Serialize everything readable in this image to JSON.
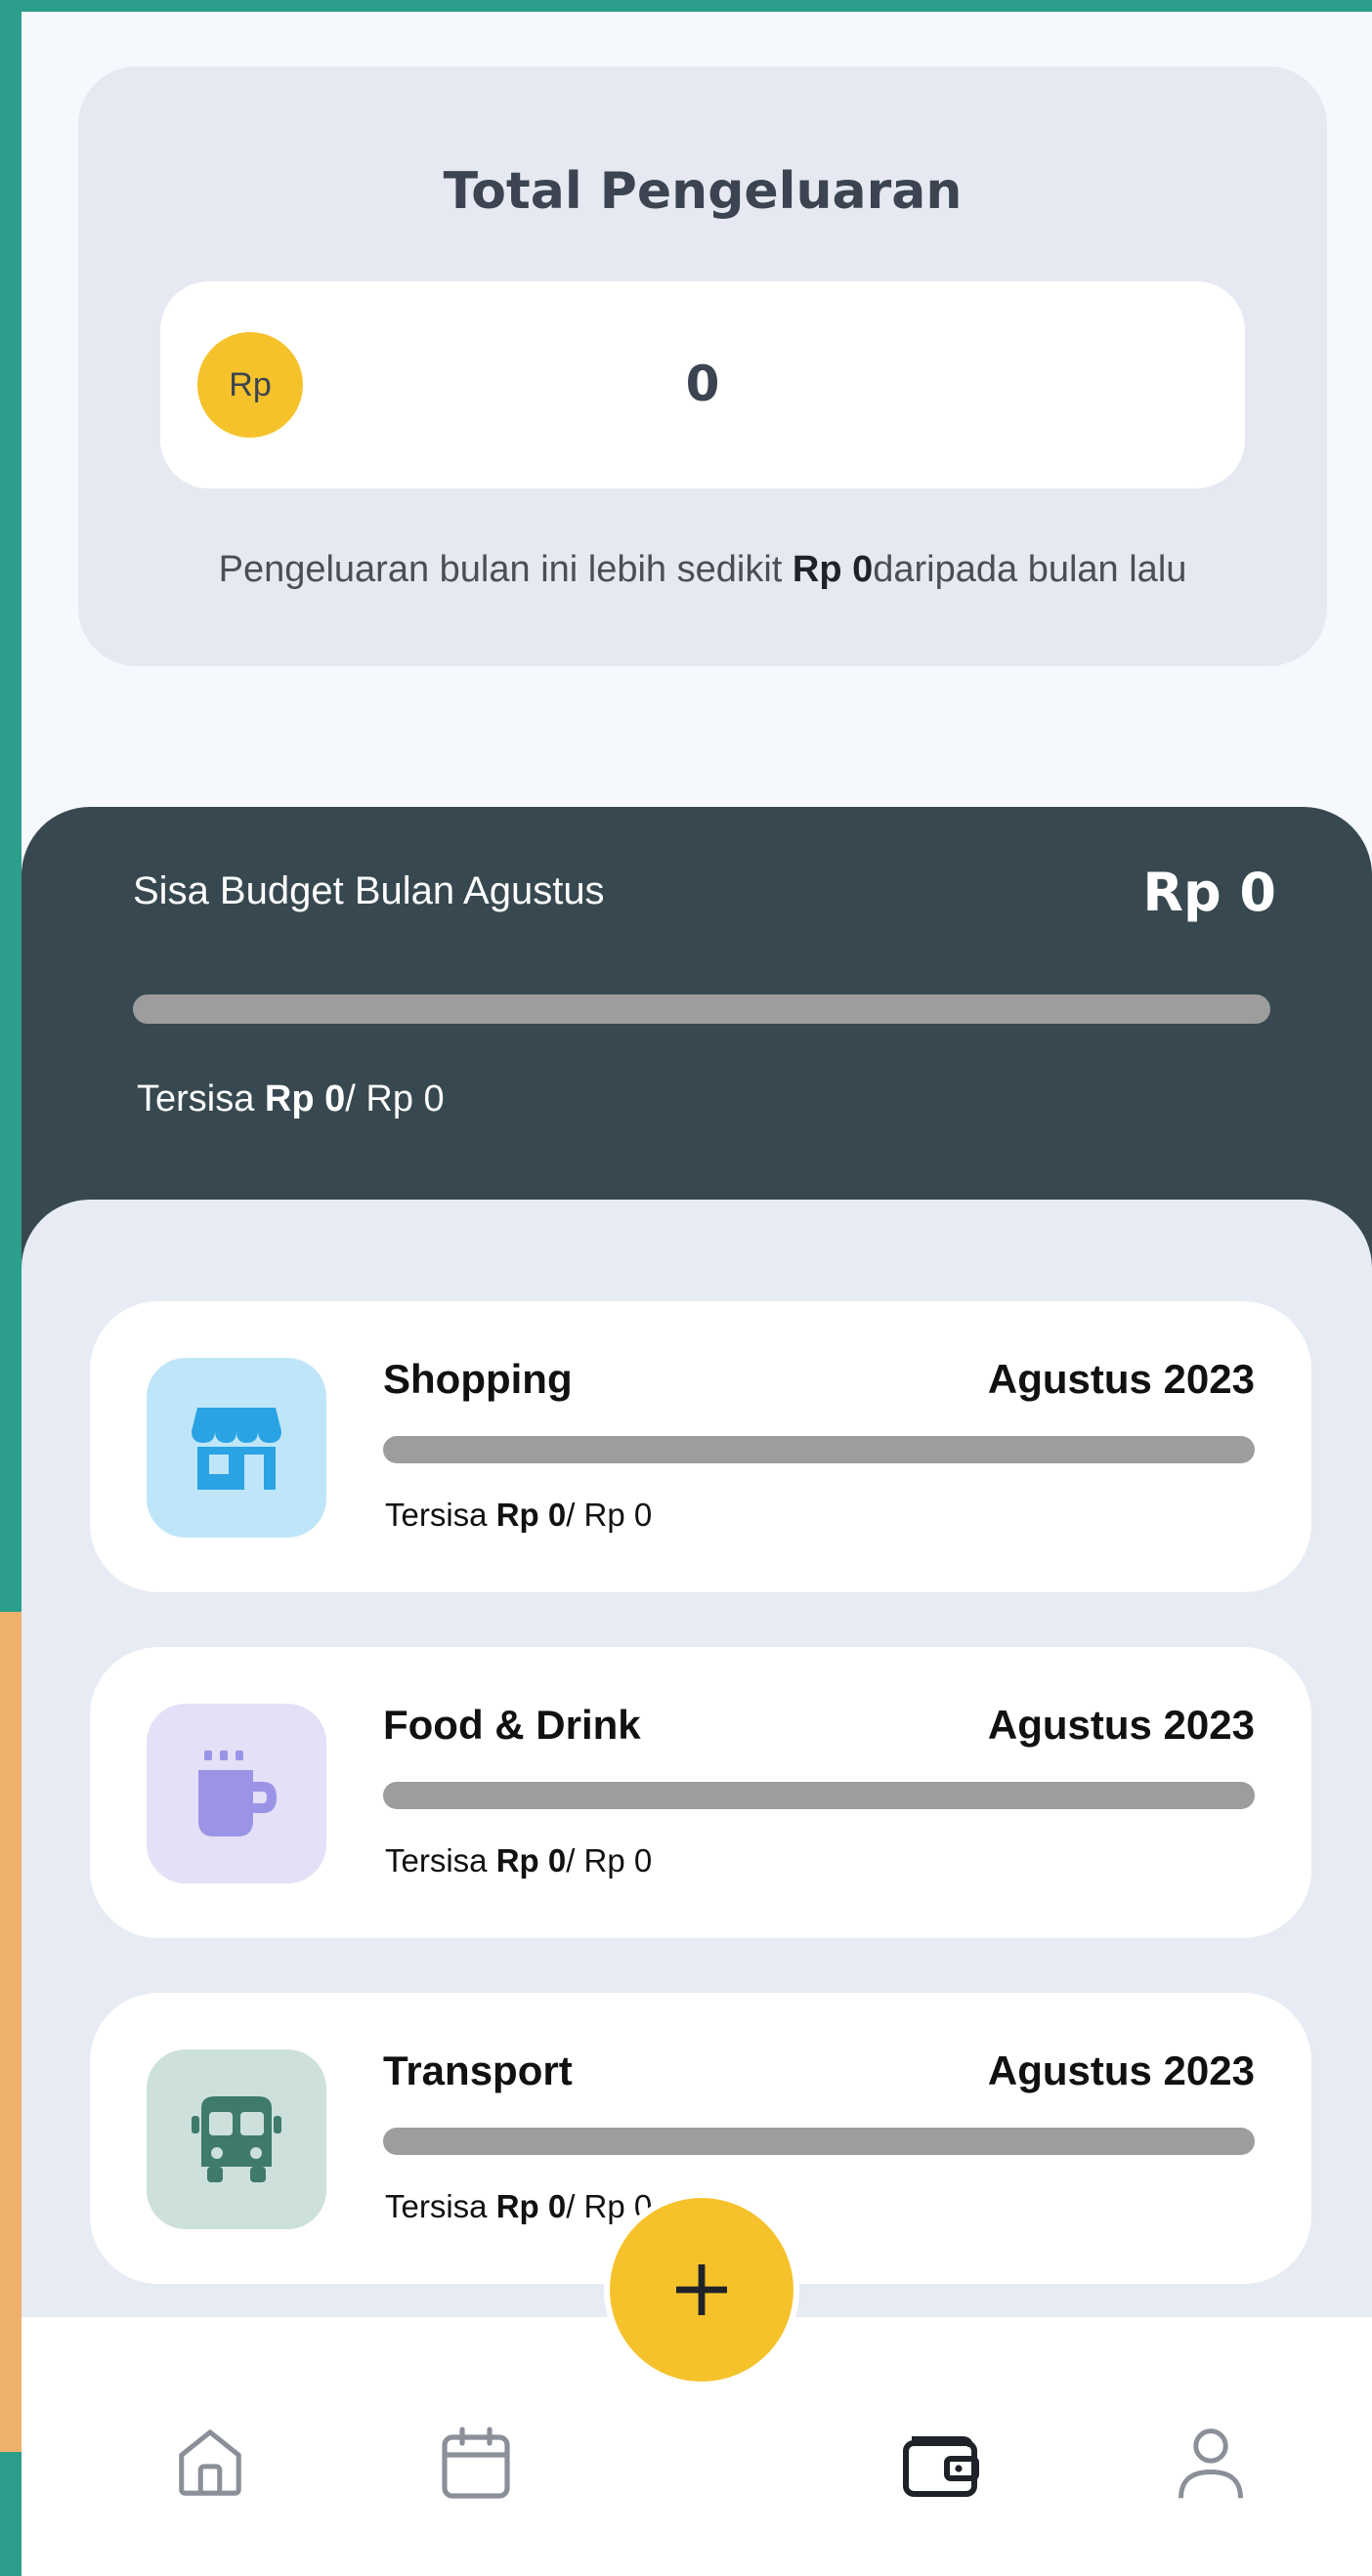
{
  "total": {
    "title": "Total Pengeluaran",
    "currency_badge": "Rp",
    "amount": "0",
    "note_prefix": "Pengeluaran bulan ini lebih sedikit ",
    "note_amount": "Rp 0",
    "note_suffix": "daripada bulan lalu"
  },
  "budget": {
    "label": "Sisa Budget Bulan Agustus",
    "value": "Rp 0",
    "progress": 0,
    "remain_prefix": "Tersisa ",
    "remain_amount": "Rp 0",
    "remain_suffix": "/ Rp 0"
  },
  "categories": [
    {
      "name": "Shopping",
      "period": "Agustus 2023",
      "icon": "shop-icon",
      "icon_bg": "#bfe6f8",
      "icon_color": "#2aa3e4",
      "progress": 0,
      "remain_prefix": "Tersisa ",
      "remain_amount": "Rp 0",
      "remain_suffix": "/ Rp 0"
    },
    {
      "name": "Food & Drink",
      "period": "Agustus 2023",
      "icon": "cup-icon",
      "icon_bg": "#e3e0f7",
      "icon_color": "#9b94e6",
      "progress": 0,
      "remain_prefix": "Tersisa ",
      "remain_amount": "Rp 0",
      "remain_suffix": "/ Rp 0"
    },
    {
      "name": "Transport",
      "period": "Agustus 2023",
      "icon": "bus-icon",
      "icon_bg": "#cde0dc",
      "icon_color": "#3f7a6c",
      "progress": 0,
      "remain_prefix": "Tersisa ",
      "remain_amount": "Rp 0",
      "remain_suffix": "/ Rp 0"
    }
  ],
  "nav": {
    "items": [
      "home-icon",
      "calendar-icon",
      "wallet-icon",
      "profile-icon"
    ],
    "active": "wallet-icon"
  },
  "fab": {
    "icon": "plus-icon"
  },
  "colors": {
    "accent": "#f6c22b",
    "dark_panel": "#374850",
    "bar_track": "#9d9d9d"
  }
}
